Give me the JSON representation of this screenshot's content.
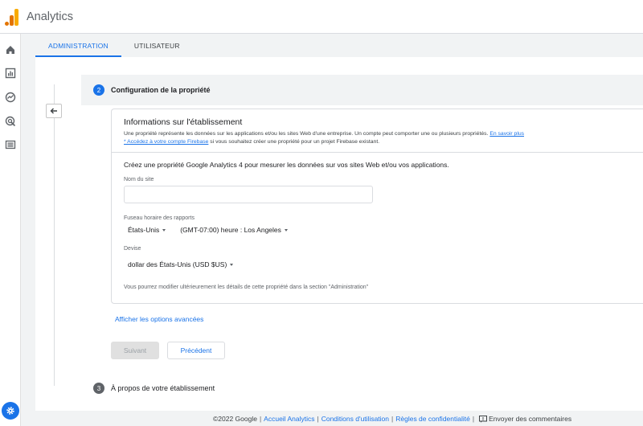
{
  "app": {
    "title": "Analytics"
  },
  "tabs": [
    {
      "label": "ADMINISTRATION",
      "active": true
    },
    {
      "label": "UTILISATEUR",
      "active": false
    }
  ],
  "nav": {
    "icons": [
      "home-icon",
      "reports-icon",
      "explore-icon",
      "advertising-icon",
      "configure-icon"
    ],
    "settings_icon": "gear-icon"
  },
  "step2": {
    "number": "2",
    "title": "Configuration de la propriété"
  },
  "card": {
    "heading": "Informations sur l'établissement",
    "desc_text": "Une propriété représente les données sur les applications et/ou les sites Web d'une entreprise. Un compte peut comporter une ou plusieurs propriétés. ",
    "learn_more": "En savoir plus",
    "firebase_link": "* Accédez à votre compte Firebase",
    "firebase_text": " si vous souhaitez créer une propriété pour un projet Firebase existant.",
    "create_text": "Créez une propriété Google Analytics 4 pour mesurer les données sur vos sites Web et/ou vos applications.",
    "site_name_label": "Nom du site",
    "site_name_value": "",
    "timezone_label": "Fuseau horaire des rapports",
    "country": "États-Unis",
    "timezone": "(GMT-07:00) heure : Los Angeles",
    "currency_label": "Devise",
    "currency": "dollar des États-Unis (USD $US)",
    "note": "Vous pourrez modifier ultérieurement les détails de cette propriété dans la section \"Administration\""
  },
  "actions": {
    "advanced": "Afficher les options avancées",
    "next": "Suivant",
    "previous": "Précédent"
  },
  "step3": {
    "number": "3",
    "title": "À propos de votre établissement"
  },
  "footer": {
    "copyright": "©2022 Google",
    "home": "Accueil Analytics",
    "terms": "Conditions d'utilisation",
    "privacy": "Règles de confidentialité",
    "feedback": "Envoyer des commentaires"
  },
  "colors": {
    "accent": "#1a73e8",
    "logo_orange": "#e37400",
    "logo_yellow": "#f9ab00"
  }
}
